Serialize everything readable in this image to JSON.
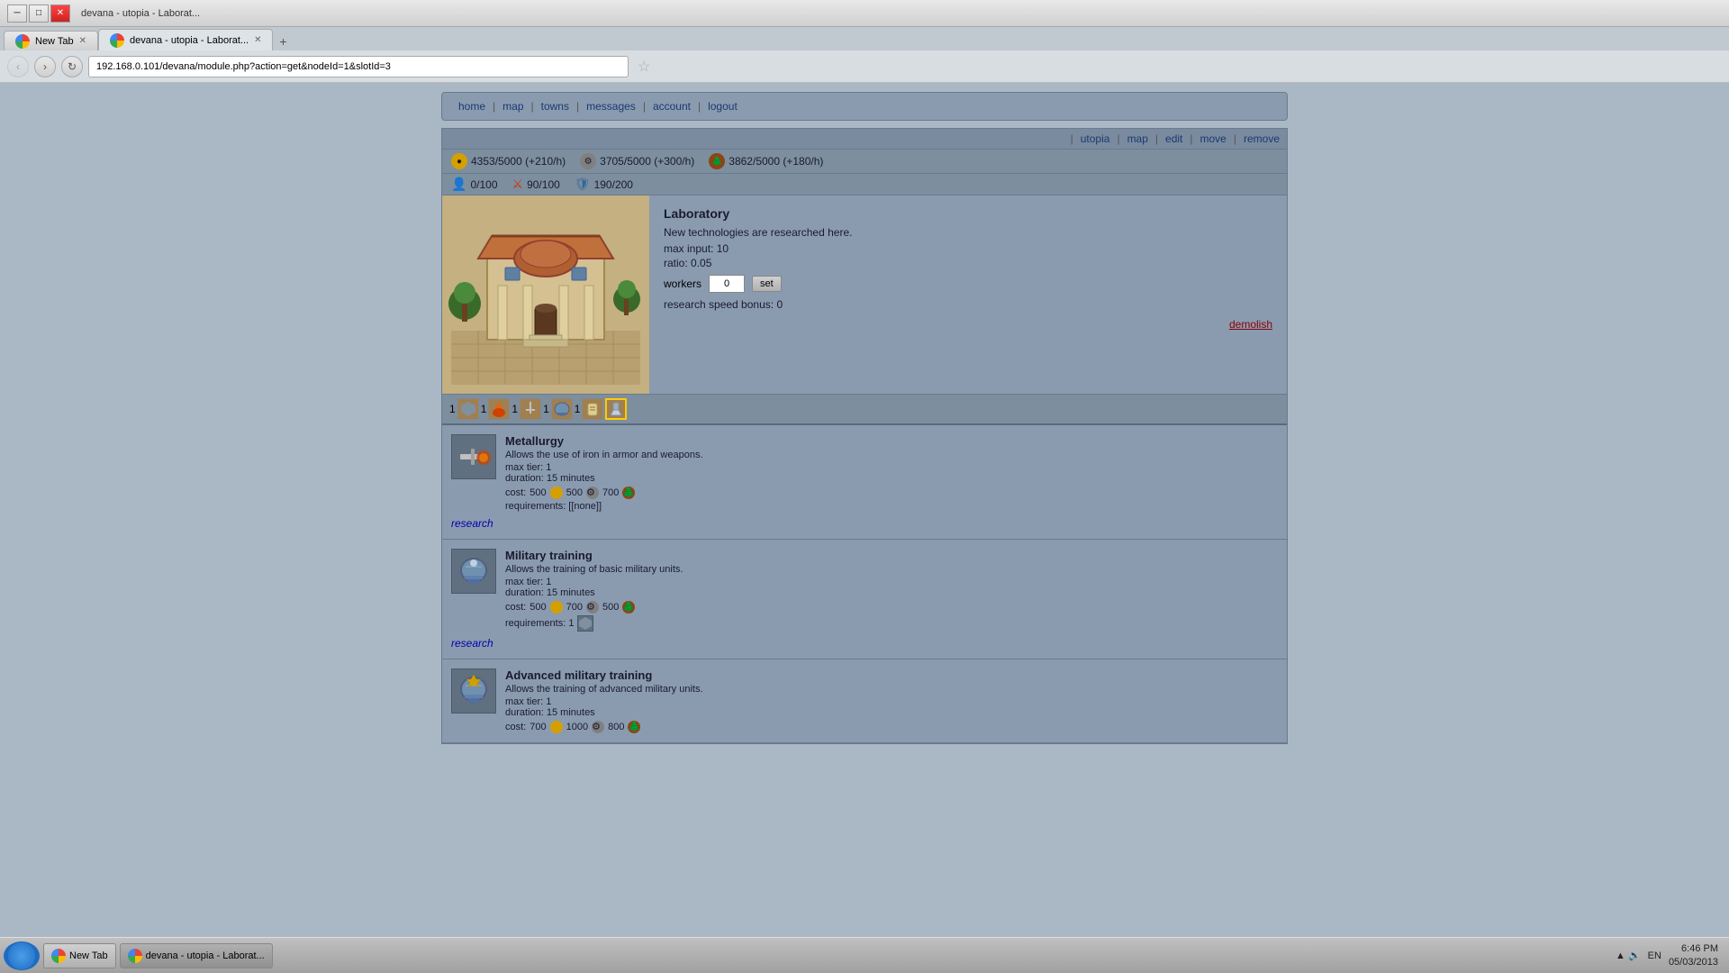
{
  "desktop": {
    "bg_top": "#87CEEB",
    "bg_bottom": "#3d7024"
  },
  "taskbar": {
    "time": "6:46 PM",
    "date": "05/03/2013",
    "lang": "EN",
    "start_btn": "Start",
    "new_tab_label": "New Tab",
    "browser_label": "devana - utopia - Laborat..."
  },
  "browser": {
    "tabs": [
      {
        "label": "New Tab",
        "active": false
      },
      {
        "label": "devana - utopia - Laborat...",
        "active": true
      }
    ],
    "new_tab_symbol": "+",
    "address": "192.168.0.101/devana/module.php?action=get&nodeId=1&slotId=3",
    "nav_back": "‹",
    "nav_forward": "›",
    "nav_reload": "↻"
  },
  "game": {
    "nav": {
      "home": "home",
      "map": "map",
      "towns": "towns",
      "messages": "messages",
      "account": "account",
      "logout": "logout"
    },
    "top_links": {
      "utopia": "utopia",
      "map": "map",
      "edit": "edit",
      "move": "move",
      "remove": "remove"
    },
    "resources": {
      "gold_current": "4353",
      "gold_max": "5000",
      "gold_rate": "+210/h",
      "iron_current": "3705",
      "iron_max": "5000",
      "iron_rate": "+300/h",
      "wood_current": "3862",
      "wood_max": "5000",
      "wood_rate": "+180/h"
    },
    "stats": {
      "pop_current": "0",
      "pop_max": "100",
      "attack_current": "90",
      "attack_max": "100",
      "defense_current": "190",
      "defense_max": "200"
    },
    "building": {
      "name": "Laboratory",
      "description": "New technologies are researched here.",
      "max_input": "10",
      "ratio": "0.05",
      "workers_value": "0",
      "workers_label": "workers",
      "set_btn": "set",
      "research_speed_label": "research speed bonus:",
      "research_speed_value": "0",
      "demolish_label": "demolish"
    },
    "slots": [
      {
        "number": "1",
        "type": "shield"
      },
      {
        "number": "1",
        "type": "flame"
      },
      {
        "number": "1",
        "type": "sword"
      },
      {
        "number": "1",
        "type": "helm"
      },
      {
        "number": "1",
        "type": "scroll"
      },
      {
        "number": "",
        "type": "lab-active"
      }
    ],
    "research_items": [
      {
        "name": "Metallurgy",
        "description": "Allows the use of iron in armor and weapons.",
        "max_tier": "1",
        "duration": "15 minutes",
        "cost_gold": "500",
        "cost_iron": "500",
        "cost_wood": "700",
        "requirements": "[none]",
        "action": "research"
      },
      {
        "name": "Military training",
        "description": "Allows the training of basic military units.",
        "max_tier": "1",
        "duration": "15 minutes",
        "cost_gold": "500",
        "cost_iron": "700",
        "cost_wood": "500",
        "req_count": "1",
        "req_type": "shield",
        "action": "research"
      },
      {
        "name": "Advanced military training",
        "description": "Allows the training of advanced military units.",
        "max_tier": "1",
        "duration": "15 minutes",
        "cost_gold": "700",
        "cost_iron": "1000",
        "cost_wood": "800",
        "requirements": "...",
        "action": "research"
      }
    ]
  }
}
